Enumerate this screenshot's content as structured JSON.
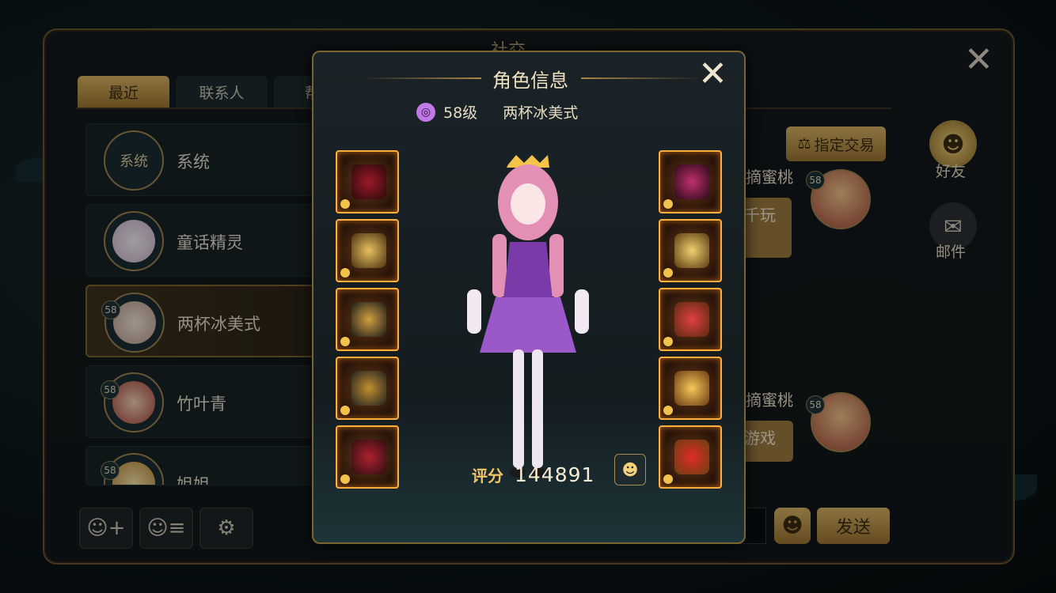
{
  "social_panel": {
    "title": "社交",
    "tabs": [
      {
        "label": "最近",
        "active": true
      },
      {
        "label": "联系人",
        "active": false
      },
      {
        "label": "帮派",
        "active": false
      }
    ],
    "contacts": [
      {
        "name": "系统",
        "avatar_text": "系统",
        "level": ""
      },
      {
        "name": "童话精灵",
        "avatar_text": "",
        "level": ""
      },
      {
        "name": "两杯冰美式",
        "avatar_text": "",
        "level": "58"
      },
      {
        "name": "竹叶青",
        "avatar_text": "",
        "level": "58"
      },
      {
        "name": "姐姐",
        "avatar_text": "",
        "level": "58"
      }
    ],
    "trade_button": "指定交易",
    "chat_snippets": [
      "摘蜜桃",
      "千玩",
      "摘蜜桃",
      "游戏"
    ],
    "right_avatar_levels": [
      "58",
      "58"
    ],
    "side_nav": [
      {
        "label": "好友",
        "icon": "friend-icon"
      },
      {
        "label": "邮件",
        "icon": "mail-icon"
      }
    ],
    "send_button": "发送"
  },
  "character_info": {
    "title": "角色信息",
    "level": "58级",
    "name": "两杯冰美式",
    "score_label": "评分",
    "score": "144891",
    "left_slots": [
      "gloves",
      "shoulder",
      "armor",
      "pants",
      "boots"
    ],
    "right_slots": [
      "weapon",
      "necklace",
      "ring",
      "earrings",
      "emblem"
    ]
  },
  "colors": {
    "accent_gold": "#d7b265",
    "slot_border": "#ffae3a",
    "class_purple": "#c278e6"
  }
}
